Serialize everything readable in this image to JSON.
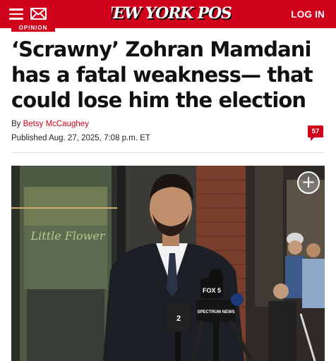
{
  "header": {
    "logo_text": "NEW YORK POST",
    "login_label": "LOG IN",
    "menu_icon": "hamburger-menu-icon",
    "mail_icon": "envelope-icon",
    "brand_color": "#d0021b"
  },
  "article": {
    "section": "OPINION",
    "headline": "‘Scrawny’ Zohran Mamdani has a fatal weakness— that could lose him the election",
    "byline_prefix": "By",
    "author": "Betsy McCaughey",
    "published": "Published Aug. 27, 2025, 7:08 p.m. ET",
    "comment_count": "57"
  },
  "photo": {
    "expand_icon": "plus-circle-icon",
    "sign_text": "Little Flower",
    "mic_labels": [
      "FOX 5",
      "SPECTRUM NEWS",
      "2"
    ]
  }
}
